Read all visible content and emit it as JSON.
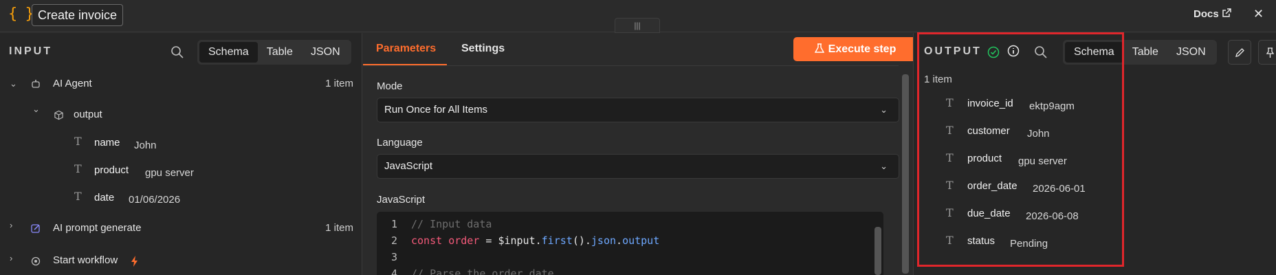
{
  "header": {
    "logo_glyph": "{ }",
    "title": "Create invoice",
    "docs_label": "Docs",
    "drag_glyph": "|||",
    "close_glyph": "✕"
  },
  "input": {
    "title": "INPUT",
    "views": [
      "Schema",
      "Table",
      "JSON"
    ],
    "active_view": "Schema",
    "nodes": [
      {
        "label": "AI Agent",
        "count": "1 item"
      },
      {
        "label": "AI prompt generate",
        "count": "1 item"
      },
      {
        "label": "Start workflow"
      }
    ],
    "output_label": "output",
    "fields": [
      {
        "name": "name",
        "value": "John"
      },
      {
        "name": "product",
        "value": "gpu server"
      },
      {
        "name": "date",
        "value": "01/06/2026"
      }
    ]
  },
  "center": {
    "tabs": [
      "Parameters",
      "Settings"
    ],
    "execute_label": "Execute step",
    "mode_label": "Mode",
    "mode_value": "Run Once for All Items",
    "language_label": "Language",
    "language_value": "JavaScript",
    "code_label": "JavaScript",
    "code_lines": [
      {
        "n": "1",
        "text": "// Input data"
      },
      {
        "n": "2",
        "text": "const order = $input.first().json.output"
      },
      {
        "n": "3",
        "text": ""
      },
      {
        "n": "4",
        "text": "// Parse the order date"
      }
    ]
  },
  "output": {
    "title": "OUTPUT",
    "views": [
      "Schema",
      "Table",
      "JSON"
    ],
    "active_view": "Schema",
    "count": "1 item",
    "fields": [
      {
        "name": "invoice_id",
        "value": "ektp9agm"
      },
      {
        "name": "customer",
        "value": "John"
      },
      {
        "name": "product",
        "value": "gpu server"
      },
      {
        "name": "order_date",
        "value": "2026-06-01"
      },
      {
        "name": "due_date",
        "value": "2026-06-08"
      },
      {
        "name": "status",
        "value": "Pending"
      }
    ]
  },
  "colors": {
    "accent": "#ff6d2d",
    "logo": "#f59e0b",
    "highlight": "#e0262b",
    "success": "#22c55e"
  }
}
